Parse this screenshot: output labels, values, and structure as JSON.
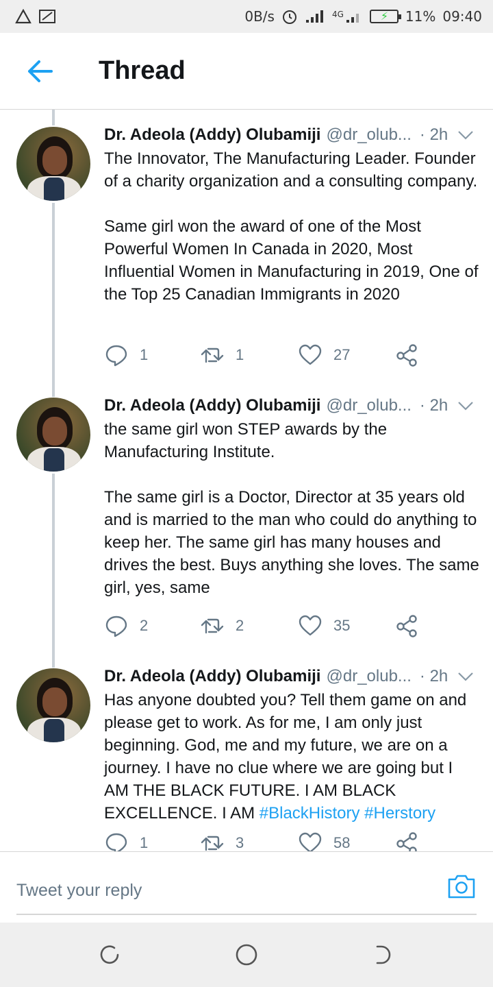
{
  "status_bar": {
    "speed": "0B/s",
    "network": "4G",
    "battery": "11%",
    "time": "09:40"
  },
  "header": {
    "title": "Thread"
  },
  "tweets": [
    {
      "name": "Dr. Adeola (Addy) Olubamiji",
      "handle": "@dr_olub...",
      "time": "· 2h",
      "text": "The Innovator, The Manufacturing Leader. Founder of a charity organization and a consulting company.\n\nSame girl won the award of one of the Most Powerful Women In Canada in 2020, Most Influential Women in Manufacturing in 2019, One of the Top 25 Canadian Immigrants in 2020",
      "hashtags": [],
      "replies": "1",
      "retweets": "1",
      "likes": "27"
    },
    {
      "name": "Dr. Adeola (Addy) Olubamiji",
      "handle": "@dr_olub...",
      "time": "· 2h",
      "text": "the same girl won STEP awards by the Manufacturing Institute.\n\nThe same girl is a Doctor, Director at 35 years old and is married to the man who could do anything to keep her. The same girl has many houses and drives the best. Buys anything she loves. The same girl, yes, same",
      "hashtags": [],
      "replies": "2",
      "retweets": "2",
      "likes": "35"
    },
    {
      "name": "Dr. Adeola (Addy) Olubamiji",
      "handle": "@dr_olub...",
      "time": "· 2h",
      "text": "Has anyone doubted you? Tell them game on and please get to work. As for me, I am only just beginning. God, me and my future, we are on a journey. I have no clue where we are going but I AM THE BLACK FUTURE. I AM BLACK EXCELLENCE. I AM ",
      "hashtags": [
        "#BlackHistory",
        "#Herstory"
      ],
      "replies": "1",
      "retweets": "3",
      "likes": "58"
    }
  ],
  "reply": {
    "placeholder": "Tweet your reply"
  },
  "colors": {
    "accent": "#1da1f2",
    "muted": "#657786",
    "text": "#14171a",
    "divider": "#d6d6d6"
  },
  "icons": {
    "back": "arrow-left-icon",
    "caret": "chevron-down-icon",
    "reply": "comment-icon",
    "retweet": "retweet-icon",
    "like": "heart-icon",
    "share": "share-icon",
    "camera": "camera-icon"
  }
}
